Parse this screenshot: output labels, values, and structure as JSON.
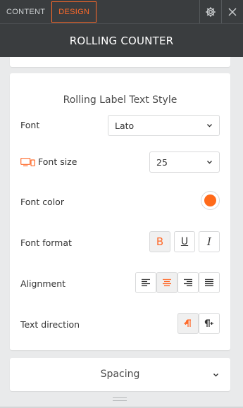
{
  "tabs": [
    {
      "label": "CONTENT",
      "active": false
    },
    {
      "label": "DESIGN",
      "active": true
    }
  ],
  "header": {
    "title": "ROLLING COUNTER"
  },
  "section": {
    "title": "Rolling Label Text Style"
  },
  "font": {
    "label": "Font",
    "value": "Lato"
  },
  "font_size": {
    "label": "Font size",
    "value": "25"
  },
  "font_color": {
    "label": "Font color",
    "value": "#ff6a1a"
  },
  "font_format": {
    "label": "Font format",
    "bold": "B",
    "underline": "U",
    "italic": "I",
    "bold_active": true
  },
  "alignment": {
    "label": "Alignment",
    "active": "center"
  },
  "text_direction": {
    "label": "Text direction",
    "active": "ltr"
  },
  "spacing": {
    "label": "Spacing"
  },
  "colors": {
    "accent": "#ff6a2a",
    "dark": "#3a3d3f"
  }
}
